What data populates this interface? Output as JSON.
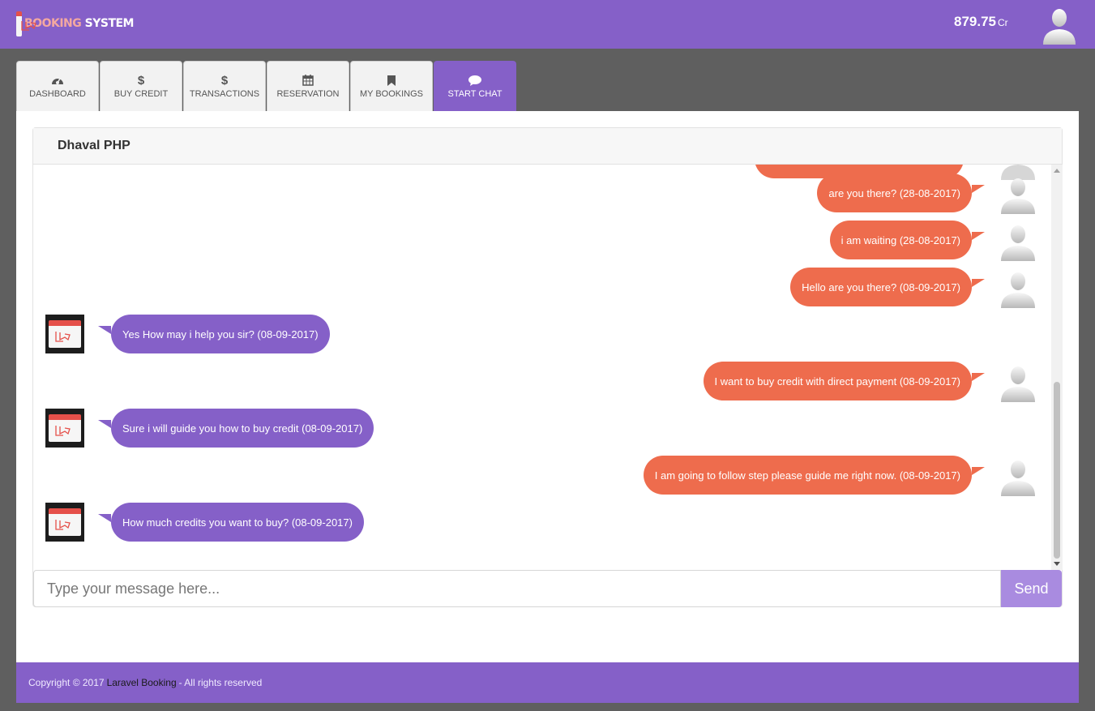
{
  "header": {
    "logo": {
      "word1": "BOOKING",
      "word2": "SYSTEM"
    },
    "credit": {
      "value": "879.75",
      "unit": "Cr"
    },
    "avatar_icon": "user-avatar-icon"
  },
  "nav": {
    "tabs": [
      {
        "label": "DASHBOARD",
        "icon": "dashboard-icon",
        "active": false
      },
      {
        "label": "BUY CREDIT",
        "icon": "dollar-icon",
        "active": false
      },
      {
        "label": "TRANSACTIONS",
        "icon": "dollar-icon",
        "active": false
      },
      {
        "label": "RESERVATION",
        "icon": "calendar-icon",
        "active": false
      },
      {
        "label": "MY BOOKINGS",
        "icon": "bookmark-icon",
        "active": false
      },
      {
        "label": "START CHAT",
        "icon": "chat-icon",
        "active": true
      }
    ]
  },
  "chat": {
    "title": "Dhaval PHP",
    "messages": [
      {
        "side": "out",
        "text": "are you there? (28-08-2017)"
      },
      {
        "side": "out",
        "text": "i am waiting (28-08-2017)"
      },
      {
        "side": "out",
        "text": "Hello are you there? (08-09-2017)"
      },
      {
        "side": "in",
        "text": "Yes How may i help you sir? (08-09-2017)"
      },
      {
        "side": "out",
        "text": "I want to buy credit with direct payment (08-09-2017)"
      },
      {
        "side": "in",
        "text": "Sure i will guide you how to buy credit (08-09-2017)"
      },
      {
        "side": "out",
        "text": "I am going to follow step please guide me right now. (08-09-2017)"
      },
      {
        "side": "in",
        "text": "How much credits you want to buy? (08-09-2017)"
      }
    ],
    "input": {
      "value": "",
      "placeholder": "Type your message here..."
    },
    "send_label": "Send"
  },
  "footer": {
    "prefix": "Copyright © 2017",
    "link": "Laravel Booking",
    "suffix": "- All rights reserved"
  },
  "colors": {
    "primary": "#8560c8",
    "outgoing_bubble": "#ee6c4d",
    "send_button": "#a98be0",
    "page_bg": "#5f5f5f"
  }
}
